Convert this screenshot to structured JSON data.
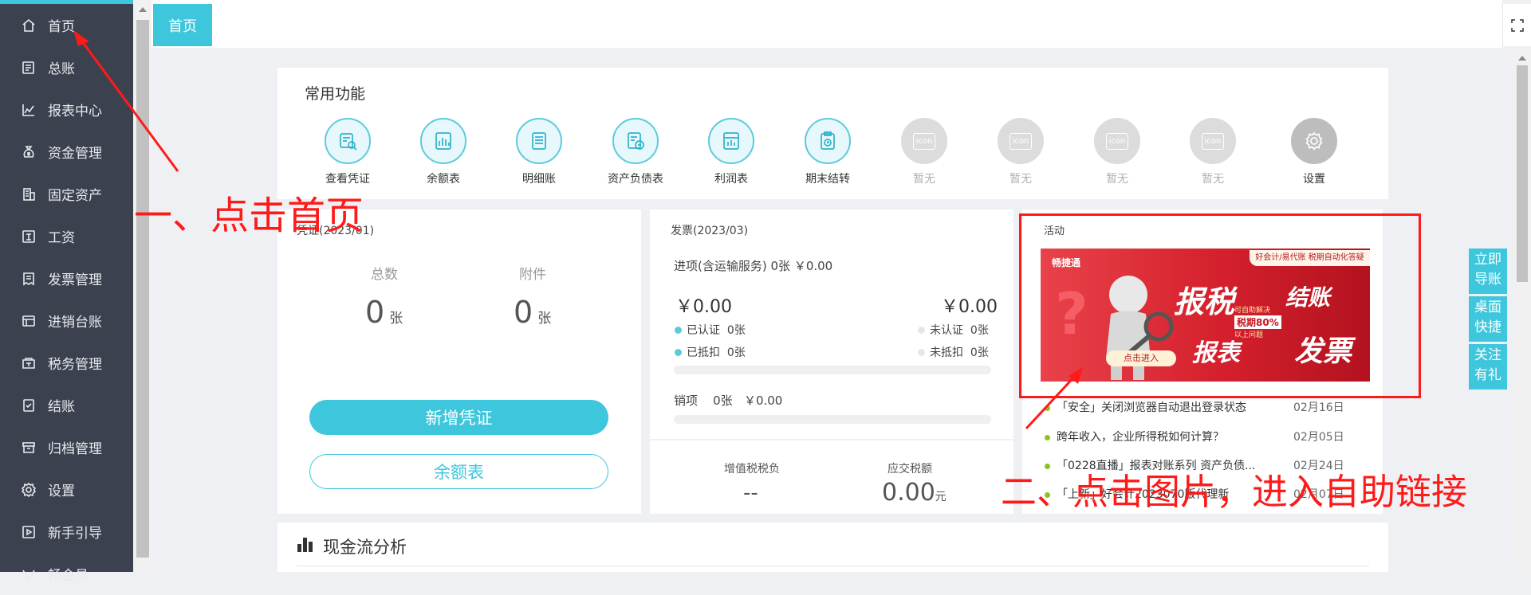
{
  "sidebar": {
    "items": [
      {
        "label": "首页",
        "icon": "home-icon"
      },
      {
        "label": "总账",
        "icon": "ledger-icon"
      },
      {
        "label": "报表中心",
        "icon": "chart-icon"
      },
      {
        "label": "资金管理",
        "icon": "money-bag-icon"
      },
      {
        "label": "固定资产",
        "icon": "building-icon"
      },
      {
        "label": "工资",
        "icon": "salary-icon"
      },
      {
        "label": "发票管理",
        "icon": "invoice-icon"
      },
      {
        "label": "进销台账",
        "icon": "register-icon"
      },
      {
        "label": "税务管理",
        "icon": "tax-icon"
      },
      {
        "label": "结账",
        "icon": "checkout-icon"
      },
      {
        "label": "归档管理",
        "icon": "archive-icon"
      },
      {
        "label": "设置",
        "icon": "gear-icon"
      },
      {
        "label": "新手引导",
        "icon": "guide-icon"
      },
      {
        "label": "畅会员",
        "icon": "vip-icon"
      }
    ]
  },
  "tabs": {
    "active": "首页"
  },
  "common_functions": {
    "title": "常用功能",
    "items": [
      {
        "label": "查看凭证",
        "icon": "voucher-search-icon"
      },
      {
        "label": "余额表",
        "icon": "balance-chart-icon"
      },
      {
        "label": "明细账",
        "icon": "detail-ledger-icon"
      },
      {
        "label": "资产负债表",
        "icon": "balance-sheet-icon"
      },
      {
        "label": "利润表",
        "icon": "profit-icon"
      },
      {
        "label": "期末结转",
        "icon": "period-end-icon"
      },
      {
        "label": "暂无",
        "icon": "placeholder-icon"
      },
      {
        "label": "暂无",
        "icon": "placeholder-icon"
      },
      {
        "label": "暂无",
        "icon": "placeholder-icon"
      },
      {
        "label": "暂无",
        "icon": "placeholder-icon"
      },
      {
        "label": "设置",
        "icon": "gear-icon"
      }
    ],
    "placeholder_text": "icon"
  },
  "voucher": {
    "title": "凭证(2023/01)",
    "total_label": "总数",
    "total_value": "0",
    "attach_label": "附件",
    "attach_value": "0",
    "unit": "张",
    "new_button": "新增凭证",
    "balance_button": "余额表"
  },
  "invoice": {
    "title": "发票(2023/03)",
    "input_line": "进项(含运输服务)",
    "input_count": "0张",
    "input_amount": "￥0.00",
    "left_amount": "￥0.00",
    "right_amount": "￥0.00",
    "certified": "已认证",
    "certified_count": "0张",
    "uncertified": "未认证",
    "uncertified_count": "0张",
    "deducted": "已抵扣",
    "deducted_count": "0张",
    "undeducted": "未抵扣",
    "undeducted_count": "0张",
    "output_label": "销项",
    "output_count": "0张",
    "output_amount": "￥0.00",
    "vat_label": "增值税税负",
    "vat_value": "--",
    "tax_due_label": "应交税额",
    "tax_due_value": "0.00",
    "tax_due_unit": "元"
  },
  "activity": {
    "title": "活动",
    "banner": {
      "brand": "畅捷通",
      "top_tag": "好会计/易代账 税期自动化答疑",
      "big1": "报税",
      "big2": "结账",
      "big3": "报表",
      "big4": "发票",
      "small1": "可自助解决",
      "small2": "税期80%",
      "small3": "以上问题",
      "cta": "点击进入"
    },
    "news": [
      {
        "title": "「安全」关闭浏览器自动退出登录状态",
        "date": "02月16日"
      },
      {
        "title": "跨年收入，企业所得税如何计算？",
        "date": "02月05日"
      },
      {
        "title": "「0228直播」报表对账系列 资产负债...",
        "date": "02月24日"
      },
      {
        "title": "「上新」好会计2023070版代理新",
        "date": "02月07日"
      }
    ]
  },
  "cashflow": {
    "title": "现金流分析"
  },
  "float_buttons": [
    "立即导账",
    "桌面快捷",
    "关注有礼"
  ],
  "annotations": {
    "step1": "一、点击首页",
    "step2": "二、点击图片，进入自助链接"
  },
  "colors": {
    "accent": "#3ec7dc",
    "sidebar": "#3c4150",
    "annotation": "#ff1a1a"
  }
}
